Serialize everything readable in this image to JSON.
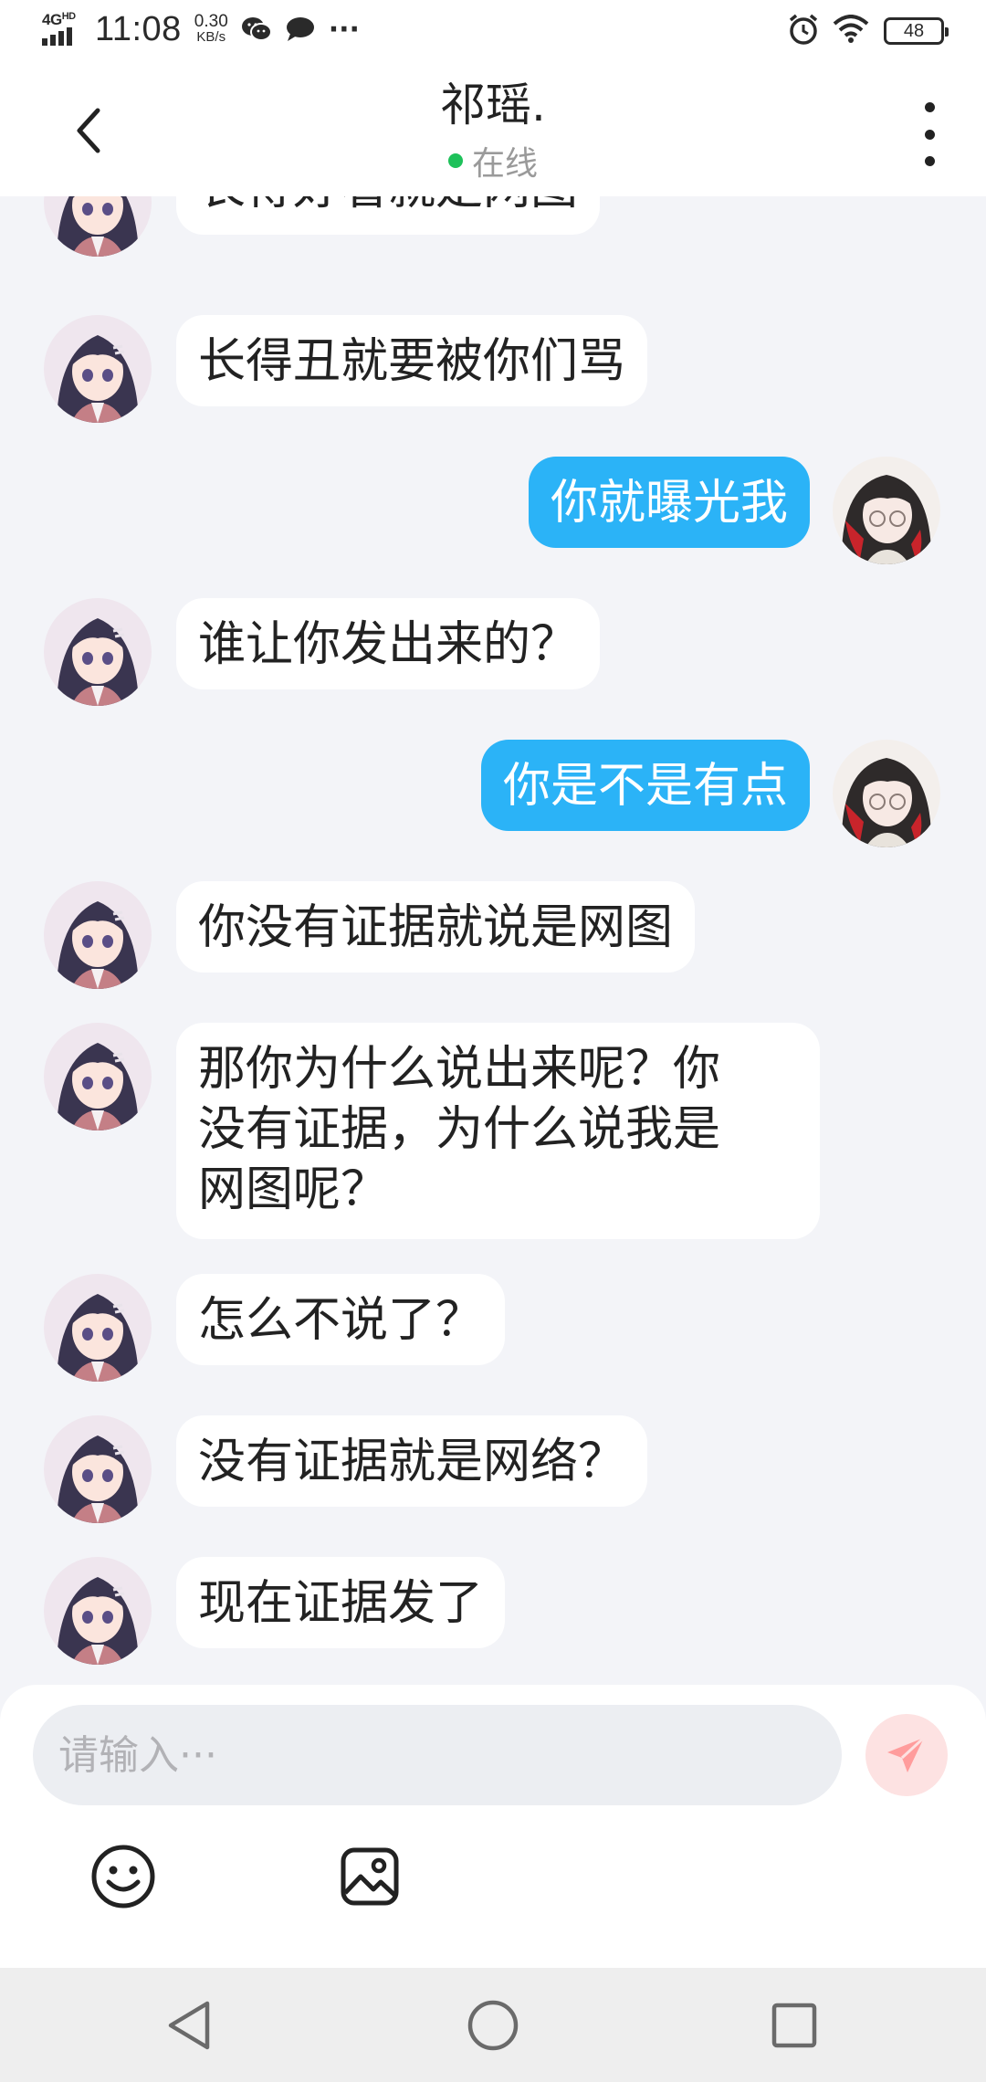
{
  "status_bar": {
    "network_type": "4G",
    "network_sub": "HD",
    "time": "11:08",
    "speed_value": "0.30",
    "speed_unit": "KB/s",
    "more_indicator": "···",
    "battery": "48",
    "icons": [
      "signal-icon",
      "wechat-icon",
      "message-bubble-icon",
      "alarm-icon",
      "wifi-icon",
      "battery-icon"
    ]
  },
  "header": {
    "title": "祁瑶.",
    "presence": "在线",
    "presence_color": "#1ec15a"
  },
  "messages": [
    {
      "side": "in",
      "text": "长得好看就是网图"
    },
    {
      "side": "in",
      "text": "长得丑就要被你们骂"
    },
    {
      "side": "out",
      "text": "你就曝光我"
    },
    {
      "side": "in",
      "text": "谁让你发出来的？"
    },
    {
      "side": "out",
      "text": "你是不是有点"
    },
    {
      "side": "in",
      "text": "你没有证据就说是网图"
    },
    {
      "side": "in",
      "text": "那你为什么说出来呢？你\n没有证据，为什么说我是\n网图呢？"
    },
    {
      "side": "in",
      "text": "怎么不说了？"
    },
    {
      "side": "in",
      "text": "没有证据就是网络？"
    },
    {
      "side": "in",
      "text": "现在证据发了"
    }
  ],
  "composer": {
    "placeholder": "请输入···"
  },
  "colors": {
    "outgoing_bubble": "#2bb3f7",
    "incoming_bubble": "#ffffff",
    "send_button_bg": "#fde2e2",
    "send_icon": "#ff9c9c"
  }
}
